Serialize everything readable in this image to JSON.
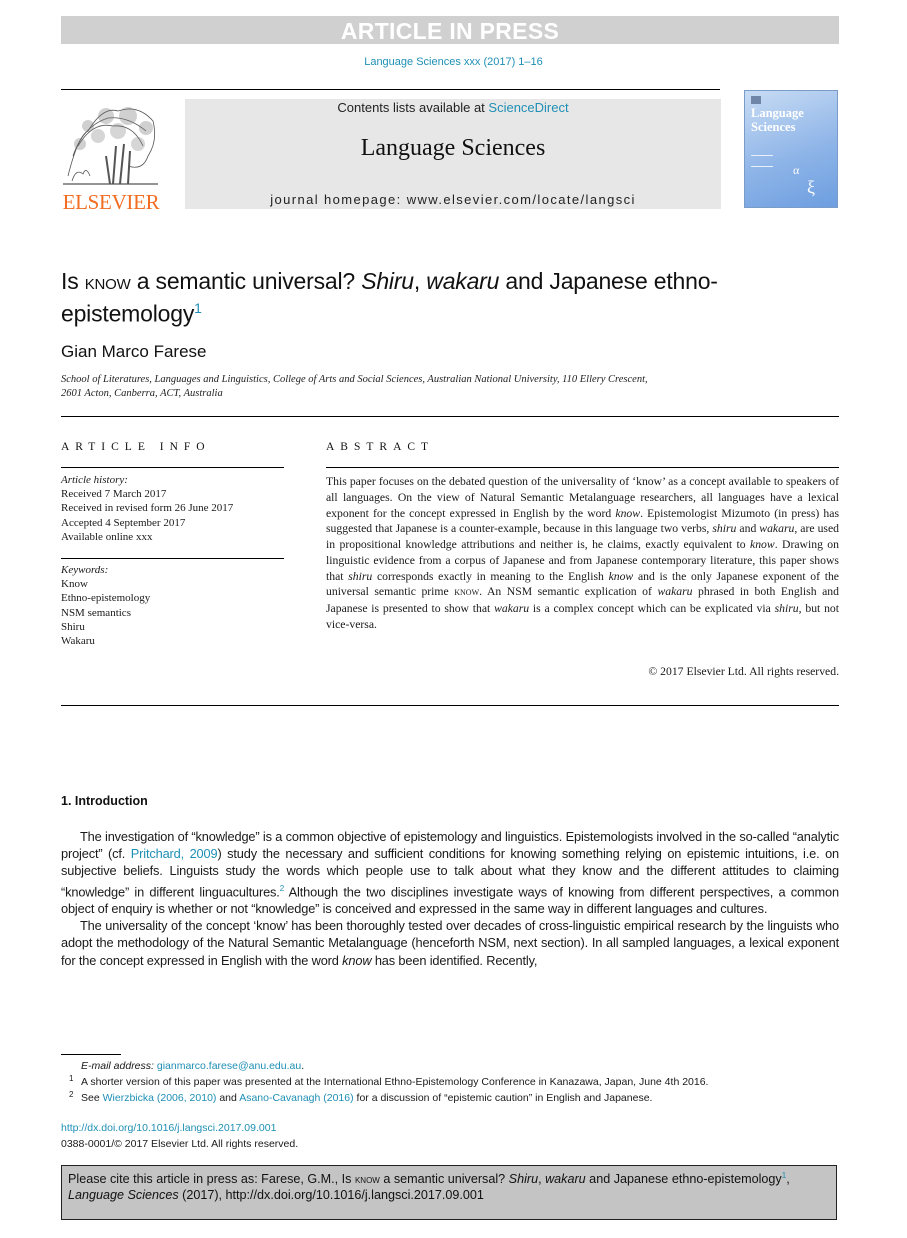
{
  "banner": {
    "text": "ARTICLE IN PRESS"
  },
  "journal_ref": "Language Sciences xxx (2017) 1–16",
  "masthead": {
    "contents_prefix": "Contents lists available at ",
    "contents_link": "ScienceDirect",
    "journal_name": "Language Sciences",
    "homepage": "journal homepage: www.elsevier.com/locate/langsci"
  },
  "publisher": {
    "logo_text": "ELSEVIER",
    "logo_icon": "tree-of-knowledge-icon",
    "brand_color": "#f26c21"
  },
  "cover": {
    "title_line1": "Language",
    "title_line2": "Sciences",
    "alpha": "α",
    "xi": "ξ"
  },
  "article": {
    "title_part1": "Is ",
    "title_smallcaps": "know",
    "title_part2": " a semantic universal? ",
    "title_italic1": "Shiru",
    "title_part3": ", ",
    "title_italic2": "wakaru",
    "title_part4": " and Japanese ethno-epistemology",
    "title_footnote": "1",
    "author": "Gian Marco Farese",
    "affiliation_line1": "School of Literatures, Languages and Linguistics, College of Arts and Social Sciences, Australian National University, 110 Ellery Crescent,",
    "affiliation_line2": "2601 Acton, Canberra, ACT, Australia"
  },
  "article_info": {
    "heading": "ARTICLE INFO",
    "history_label": "Article history:",
    "history": [
      "Received 7 March 2017",
      "Received in revised form 26 June 2017",
      "Accepted 4 September 2017",
      "Available online xxx"
    ],
    "keywords_label": "Keywords:",
    "keywords": [
      "Know",
      "Ethno-epistemology",
      "NSM semantics",
      "Shiru",
      "Wakaru"
    ]
  },
  "abstract": {
    "heading": "ABSTRACT",
    "s1": "This paper focuses on the debated question of the universality of ‘know’ as a concept available to speakers of all languages. On the view of Natural Semantic Metalanguage researchers, all languages have a lexical exponent for the concept expressed in English by the word ",
    "i1": "know",
    "s2": ". Epistemologist Mizumoto (in press) has suggested that Japanese is a counter-example, because in this language two verbs, ",
    "i2": "shiru",
    "s3": " and ",
    "i3": "wakaru",
    "s4": ", are used in propositional knowledge attributions and neither is, he claims, exactly equivalent to ",
    "i4": "know",
    "s5": ". Drawing on linguistic evidence from a corpus of Japanese and from Japanese contemporary literature, this paper shows that ",
    "i5": "shiru",
    "s6": " corresponds exactly in meaning to the English ",
    "i6": "know",
    "s7": " and is the only Japanese exponent of the universal semantic prime ",
    "sc1": "know",
    "s8": ". An NSM semantic explication of ",
    "i7": "wakaru",
    "s9": " phrased in both English and Japanese is presented to show that ",
    "i8": "wakaru",
    "s10": " is a complex concept which can be explicated via ",
    "i9": "shiru",
    "s11": ", but not vice-versa.",
    "copyright": "© 2017 Elsevier Ltd. All rights reserved."
  },
  "introduction": {
    "heading": "1.  Introduction",
    "p1_a": "The investigation of “knowledge” is a common objective of epistemology and linguistics. Epistemologists involved in the so-called “analytic project” (cf. ",
    "p1_link": "Pritchard, 2009",
    "p1_b": ") study the necessary and sufficient conditions for knowing something relying on epistemic intuitions, i.e. on subjective beliefs. Linguists study the words which people use to talk about what they know and the different attitudes to claiming “knowledge” in different linguacultures.",
    "p1_fn": "2",
    "p1_c": " Although the two disciplines investigate ways of knowing from different perspectives, a common object of enquiry is whether or not “knowledge” is conceived and expressed in the same way in different languages and cultures.",
    "p2_a": "The universality of the concept ‘know’ has been thoroughly tested over decades of cross-linguistic empirical research by the linguists who adopt the methodology of the Natural Semantic Metalanguage (henceforth NSM, next section). In all sampled languages, a lexical exponent for the concept expressed in English with the word ",
    "p2_i": "know",
    "p2_b": " has been identified. Recently,"
  },
  "footnotes": {
    "email_label": "E-mail address: ",
    "email": "gianmarco.farese@anu.edu.au",
    "email_end": ".",
    "fn1_mark": "1",
    "fn1": "A shorter version of this paper was presented at the International Ethno-Epistemology Conference in Kanazawa, Japan, June 4th 2016.",
    "fn2_mark": "2",
    "fn2_a": "See ",
    "fn2_link1": "Wierzbicka (2006, 2010)",
    "fn2_b": " and ",
    "fn2_link2": "Asano-Cavanagh (2016)",
    "fn2_c": " for a discussion of “epistemic caution” in English and Japanese."
  },
  "doi": {
    "link": "http://dx.doi.org/10.1016/j.langsci.2017.09.001",
    "issn": "0388-0001/© 2017 Elsevier Ltd. All rights reserved."
  },
  "citation": {
    "a": "Please cite this article in press as: Farese, G.M., Is ",
    "sc": "know",
    "b": " a semantic universal? ",
    "i1": "Shiru",
    "c": ", ",
    "i2": "wakaru",
    "d": " and Japanese ethno-epistemology",
    "fn": "1",
    "e": ",",
    "journal": "Language Sciences",
    "f": " (2017), http://dx.doi.org/10.1016/j.langsci.2017.09.001"
  },
  "colors": {
    "link": "#1f8fb5",
    "banner_bg": "#d0d0d0",
    "masthead_bg": "#e7e7e7",
    "cite_bg": "#c4c4c4"
  }
}
